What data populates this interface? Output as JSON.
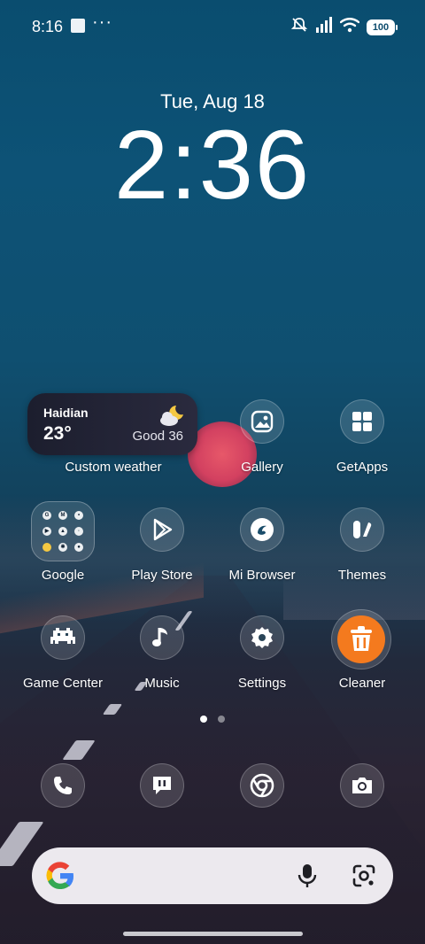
{
  "status_bar": {
    "time": "8:16",
    "dots": "···",
    "battery": "100"
  },
  "lock_clock": {
    "date": "Tue, Aug 18",
    "time": "2:36"
  },
  "weather_widget": {
    "city": "Haidian",
    "temperature": "23°",
    "air_quality": "Good 36",
    "label": "Custom weather",
    "icon": "partly-cloudy-night-icon"
  },
  "apps": {
    "gallery": {
      "label": "Gallery",
      "icon": "gallery-icon"
    },
    "getapps": {
      "label": "GetApps",
      "icon": "getapps-icon"
    },
    "google": {
      "label": "Google",
      "icon": "google-folder-icon"
    },
    "play_store": {
      "label": "Play Store",
      "icon": "play-store-icon"
    },
    "mi_browser": {
      "label": "Mi Browser",
      "icon": "mi-browser-icon"
    },
    "themes": {
      "label": "Themes",
      "icon": "themes-icon"
    },
    "game_center": {
      "label": "Game Center",
      "icon": "game-center-icon"
    },
    "music": {
      "label": "Music",
      "icon": "music-icon"
    },
    "settings": {
      "label": "Settings",
      "icon": "settings-icon"
    },
    "cleaner": {
      "label": "Cleaner",
      "icon": "cleaner-icon"
    }
  },
  "page_indicator": {
    "pages": 2,
    "current": 1
  },
  "dock": [
    {
      "name": "phone",
      "icon": "phone-icon"
    },
    {
      "name": "messages",
      "icon": "messages-icon"
    },
    {
      "name": "chrome",
      "icon": "chrome-icon"
    },
    {
      "name": "camera",
      "icon": "camera-icon"
    }
  ],
  "search_bar": {
    "logo": "google-logo",
    "mic": "mic-icon",
    "lens": "lens-icon"
  },
  "colors": {
    "cleaner_accent": "#f47a1e",
    "search_bg": "#ece9ee"
  }
}
